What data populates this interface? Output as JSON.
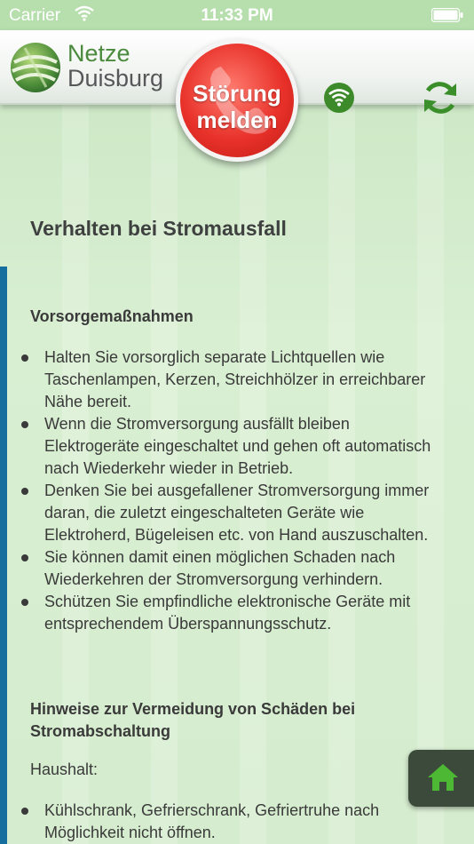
{
  "status_bar": {
    "carrier": "Carrier",
    "time": "11:33 PM",
    "wifi_icon": "wifi-icon",
    "battery_icon": "battery-icon"
  },
  "header": {
    "brand_line1": "Netze",
    "brand_line2": "Duisburg",
    "report_button": {
      "line1": "Störung",
      "line2": "melden"
    },
    "icons": [
      "logo-icon",
      "wifi-status-icon",
      "refresh-icon"
    ],
    "colors": {
      "brand_green": "#4a8a3c",
      "report_red": "#e8322a",
      "accent_blue": "#156e9e"
    }
  },
  "content": {
    "title": "Verhalten bei Stromausfall",
    "section1_heading": "Vorsorgemaßnahmen",
    "section1_items": [
      "Halten Sie vorsorglich separate Lichtquellen wie Taschenlampen, Kerzen, Streichhölzer in erreichbarer Nähe bereit.",
      "Wenn die Stromversorgung ausfällt bleiben Elektrogeräte eingeschaltet und gehen oft automatisch nach Wiederkehr wieder in Betrieb.",
      "Denken Sie bei ausgefallener Stromversorgung immer daran, die zuletzt eingeschalteten Geräte wie Elektroherd, Bügeleisen etc. von Hand auszuschalten.",
      "Sie können damit einen möglichen Schaden nach Wiederkehren der Stromversorgung verhindern.",
      "Schützen Sie empfindliche elektronische Geräte mit entsprechendem Überspannungsschutz."
    ],
    "section2_heading": "Hinweise zur  Vermeidung von Schäden bei Stromabschaltung",
    "section2_sub": "Haushalt:",
    "section2_items": [
      "Kühlschrank, Gefrierschrank, Gefriertruhe nach Möglichkeit nicht öffnen."
    ]
  },
  "home_button": {
    "icon": "home-icon"
  }
}
